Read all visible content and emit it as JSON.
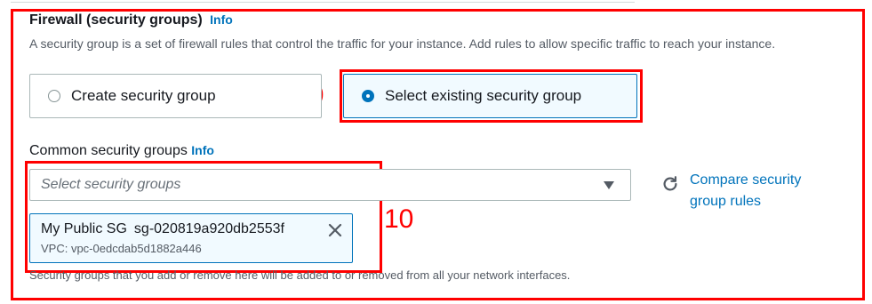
{
  "firewall": {
    "title": "Firewall (security groups)",
    "info_label": "Info",
    "description": "A security group is a set of firewall rules that control the traffic for your instance. Add rules to allow specific traffic to reach your instance."
  },
  "radio_options": [
    {
      "label": "Create security group",
      "selected": false
    },
    {
      "label": "Select existing security group",
      "selected": true
    }
  ],
  "common_groups": {
    "label": "Common security groups",
    "info_label": "Info",
    "placeholder": "Select security groups",
    "compare_label": "Compare security group rules"
  },
  "selected_group": {
    "name": "My Public SG",
    "id": "sg-020819a920db2553f",
    "vpc": "VPC: vpc-0edcdab5d1882a446"
  },
  "footer_text": "Security groups that you add or remove here will be added to or removed from all your network interfaces.",
  "annotations": {
    "step_9": "9",
    "step_10": "10"
  },
  "colors": {
    "accent": "#0073bb",
    "annotation": "#ff0000",
    "text": "#16191f",
    "muted": "#545b64"
  },
  "icons": {
    "dropdown": "caret-down-icon",
    "refresh": "refresh-icon",
    "remove": "close-icon"
  }
}
